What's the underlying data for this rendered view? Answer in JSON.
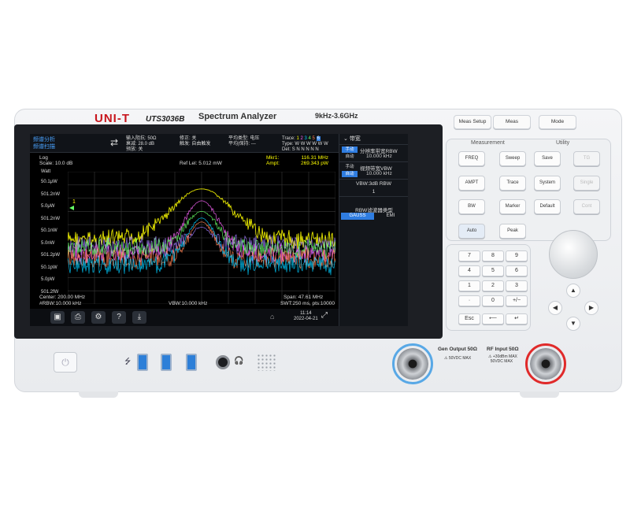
{
  "panel": {
    "brand": "UNI-T",
    "model": "UTS3036B",
    "title": "Spectrum Analyzer",
    "freq_range": "9kHz-3.6GHz"
  },
  "screen": {
    "mode_line1": "频谱分析",
    "mode_line2": "频谱扫描",
    "swap_icon": "⇄",
    "status_col1": [
      "输入阻抗: 50Ω",
      "衰减: 28.0 dB",
      "预放: 关"
    ],
    "status_col2": [
      "修正: 关",
      "触发: 自由触发"
    ],
    "status_col3": [
      "平均类型: 电压",
      "平均|保持: ---"
    ],
    "trace_rows": {
      "trace_label": "Trace:",
      "trace_nums": [
        "1",
        "2",
        "3",
        "4",
        "5",
        "6"
      ],
      "type_label": "Type:",
      "type_vals": "W W W W W W",
      "det_label": "Det:",
      "det_vals": "S N N N N N"
    },
    "scale_mode": "Log",
    "scale": "Scale: 10.0 dB",
    "ref_level": "Ref Lel: 5.012 mW",
    "unit": "Watt",
    "marker_label": "Mkr1:",
    "marker_freq": "116.31 MHz",
    "ampt_label": "Ampt:",
    "marker_ampt": "269.343 pW",
    "marker_tag": "1",
    "y_labels": [
      "50.1μW",
      "501.2nW",
      "5.0μW",
      "501.2nW",
      "50.1nW",
      "5.0nW",
      "501.2pW",
      "50.1pW",
      "5.0pW",
      "501.2fW"
    ],
    "center": "Center: 200.00 MHz",
    "rbw": "#RBW:10.000 kHz",
    "vbw": "VBW:10.000 kHz",
    "span": "Span: 47.61 MHz",
    "swt": "SWT:250 ms, pts:10000",
    "time": "11:14",
    "date": "2022-04-21",
    "menu_title": "带宽",
    "menu": {
      "rbw_manual": "手动",
      "rbw_auto": "自动",
      "rbw_label": "分辨率带宽RBW",
      "rbw_value": "10.000 kHz",
      "vbw_manual": "手动",
      "vbw_auto": "自动",
      "vbw_label": "视频带宽VBW",
      "vbw_value": "10.000 kHz",
      "ratio_label": "VBW:3dB RBW",
      "ratio_value": "1",
      "filter_label": "RBW滤波器类型",
      "filter_gauss": "GAUSS",
      "filter_emi": "EMI"
    }
  },
  "top_buttons": [
    "Meas Setup",
    "Meas",
    "Mode"
  ],
  "sections": {
    "measurement": "Measurement",
    "utility": "Utility"
  },
  "keys": {
    "freq": "FREQ",
    "sweep": "Sweep",
    "save": "Save",
    "tg": "TG",
    "ampt": "AMPT",
    "trace": "Trace",
    "system": "System",
    "single": "Single",
    "bw": "BW",
    "marker": "Marker",
    "default": "Default",
    "cont": "Cont",
    "auto": "Auto",
    "peak": "Peak"
  },
  "numpad": [
    "7",
    "8",
    "9",
    "4",
    "5",
    "6",
    "1",
    "2",
    "3",
    "·",
    "0",
    "+/−"
  ],
  "numpad_bottom": {
    "esc": "Esc",
    "back": "⟵",
    "enter": "↵"
  },
  "arrows": {
    "up": "▲",
    "down": "▼",
    "left": "◀",
    "right": "▶"
  },
  "ports": {
    "gen_label": "Gen Output 50Ω",
    "gen_warn": "50VDC MAX",
    "rf_label": "RF Input 50Ω",
    "rf_warn1": "+30dBm MAX",
    "rf_warn2": "50VDC MAX"
  },
  "colors": {
    "accent": "#2f7de1",
    "brand": "#c8161d",
    "gen_ring": "#58a8e6",
    "rf_ring": "#e02a2a"
  },
  "chart_data": {
    "type": "line",
    "series": [
      {
        "name": "1",
        "color": "#ffff00"
      },
      {
        "name": "2",
        "color": "#ff66ff"
      },
      {
        "name": "3",
        "color": "#00ccff"
      },
      {
        "name": "4",
        "color": "#66ff66"
      },
      {
        "name": "5",
        "color": "#ff7f50"
      },
      {
        "name": "6",
        "color": "#a07bff"
      }
    ]
  }
}
